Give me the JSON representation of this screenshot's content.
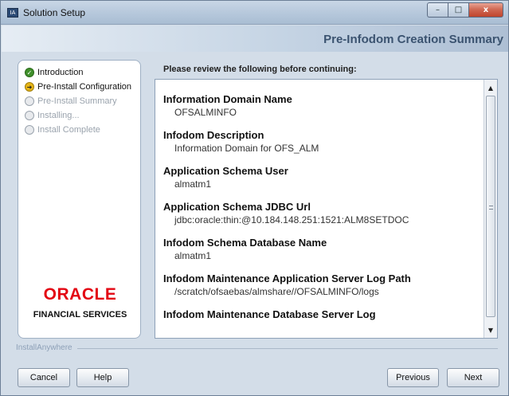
{
  "window": {
    "title": "Solution Setup",
    "app_icon_text": "IA",
    "controls": {
      "minimize": "–",
      "maximize": "□",
      "close": "x"
    }
  },
  "header": {
    "title": "Pre-Infodom Creation Summary"
  },
  "steps": [
    {
      "label": "Introduction",
      "state": "done",
      "icon": "check-icon"
    },
    {
      "label": "Pre-Install Configuration",
      "state": "current",
      "icon": "arrow-right-icon"
    },
    {
      "label": "Pre-Install Summary",
      "state": "pending",
      "icon": "circle-icon"
    },
    {
      "label": "Installing...",
      "state": "pending",
      "icon": "circle-icon"
    },
    {
      "label": "Install Complete",
      "state": "pending",
      "icon": "circle-icon"
    }
  ],
  "logo": {
    "brand": "ORACLE",
    "subtitle": "FINANCIAL SERVICES"
  },
  "content": {
    "intro": "Please review the following before continuing:",
    "items": [
      {
        "label": "Information Domain Name",
        "value": "OFSALMINFO"
      },
      {
        "label": "Infodom Description",
        "value": "Information Domain for OFS_ALM"
      },
      {
        "label": "Application Schema User",
        "value": "almatm1"
      },
      {
        "label": "Application Schema JDBC Url",
        "value": "jdbc:oracle:thin:@10.184.148.251:1521:ALM8SETDOC"
      },
      {
        "label": "Infodom Schema Database Name",
        "value": "almatm1"
      },
      {
        "label": "Infodom Maintenance Application Server Log Path",
        "value": "/scratch/ofsaebas/almshare//OFSALMINFO/logs"
      },
      {
        "label": "Infodom Maintenance Database Server Log",
        "value": ""
      }
    ]
  },
  "footer": {
    "brand_label": "InstallAnywhere",
    "buttons": {
      "cancel": "Cancel",
      "help": "Help",
      "previous": "Previous",
      "next": "Next"
    }
  },
  "colors": {
    "oracle_red": "#e30613",
    "header_title": "#3b5370",
    "close_button": "#c0442c",
    "step_done": "#3f8f2a",
    "step_current": "#e6b517"
  }
}
